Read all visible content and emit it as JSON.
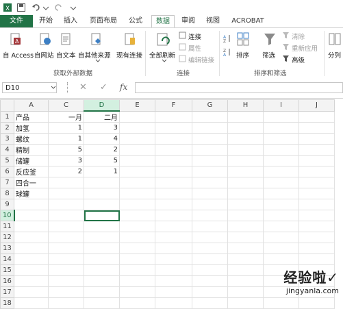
{
  "tabs": [
    "文件",
    "开始",
    "插入",
    "页面布局",
    "公式",
    "数据",
    "审阅",
    "视图",
    "ACROBAT"
  ],
  "ribbon": {
    "get_external": {
      "buttons": [
        "自 Access",
        "自网站",
        "自文本",
        "自其他来源",
        "现有连接"
      ],
      "label": "获取外部数据"
    },
    "connections": {
      "refresh": "全部刷新",
      "connect": "连接",
      "properties": "属性",
      "edit_links": "编辑链接",
      "label": "连接"
    },
    "sort_filter": {
      "sort": "排序",
      "filter": "筛选",
      "clear": "清除",
      "reapply": "重新应用",
      "advanced": "高级",
      "label": "排序和筛选"
    },
    "split": "分列"
  },
  "formula_bar": {
    "name_box": "D10",
    "cancel": "✕",
    "enter": "✓",
    "fx": "fx",
    "content": ""
  },
  "columns": [
    "A",
    "C",
    "D",
    "E",
    "F",
    "G",
    "H",
    "I",
    "J"
  ],
  "rows": [
    {
      "n": "1",
      "a": "产品",
      "c": "一月",
      "d": "二月"
    },
    {
      "n": "2",
      "a": "加氢",
      "c": "1",
      "d": "3"
    },
    {
      "n": "3",
      "a": "螺纹",
      "c": "1",
      "d": "4"
    },
    {
      "n": "4",
      "a": "精制",
      "c": "5",
      "d": "2"
    },
    {
      "n": "5",
      "a": "储罐",
      "c": "3",
      "d": "5"
    },
    {
      "n": "6",
      "a": "反应釜",
      "c": "2",
      "d": "1"
    },
    {
      "n": "7",
      "a": "四合一",
      "c": "",
      "d": ""
    },
    {
      "n": "8",
      "a": "球罐",
      "c": "",
      "d": ""
    },
    {
      "n": "9",
      "a": "",
      "c": "",
      "d": ""
    },
    {
      "n": "10",
      "a": "",
      "c": "",
      "d": ""
    },
    {
      "n": "11",
      "a": "",
      "c": "",
      "d": ""
    },
    {
      "n": "12",
      "a": "",
      "c": "",
      "d": ""
    },
    {
      "n": "13",
      "a": "",
      "c": "",
      "d": ""
    },
    {
      "n": "14",
      "a": "",
      "c": "",
      "d": ""
    },
    {
      "n": "15",
      "a": "",
      "c": "",
      "d": ""
    },
    {
      "n": "16",
      "a": "",
      "c": "",
      "d": ""
    },
    {
      "n": "17",
      "a": "",
      "c": "",
      "d": ""
    },
    {
      "n": "18",
      "a": "",
      "c": "",
      "d": ""
    }
  ],
  "watermark": {
    "title": "经验啦✓",
    "site": "jingyanla.com"
  },
  "colors": {
    "accent": "#217346"
  }
}
